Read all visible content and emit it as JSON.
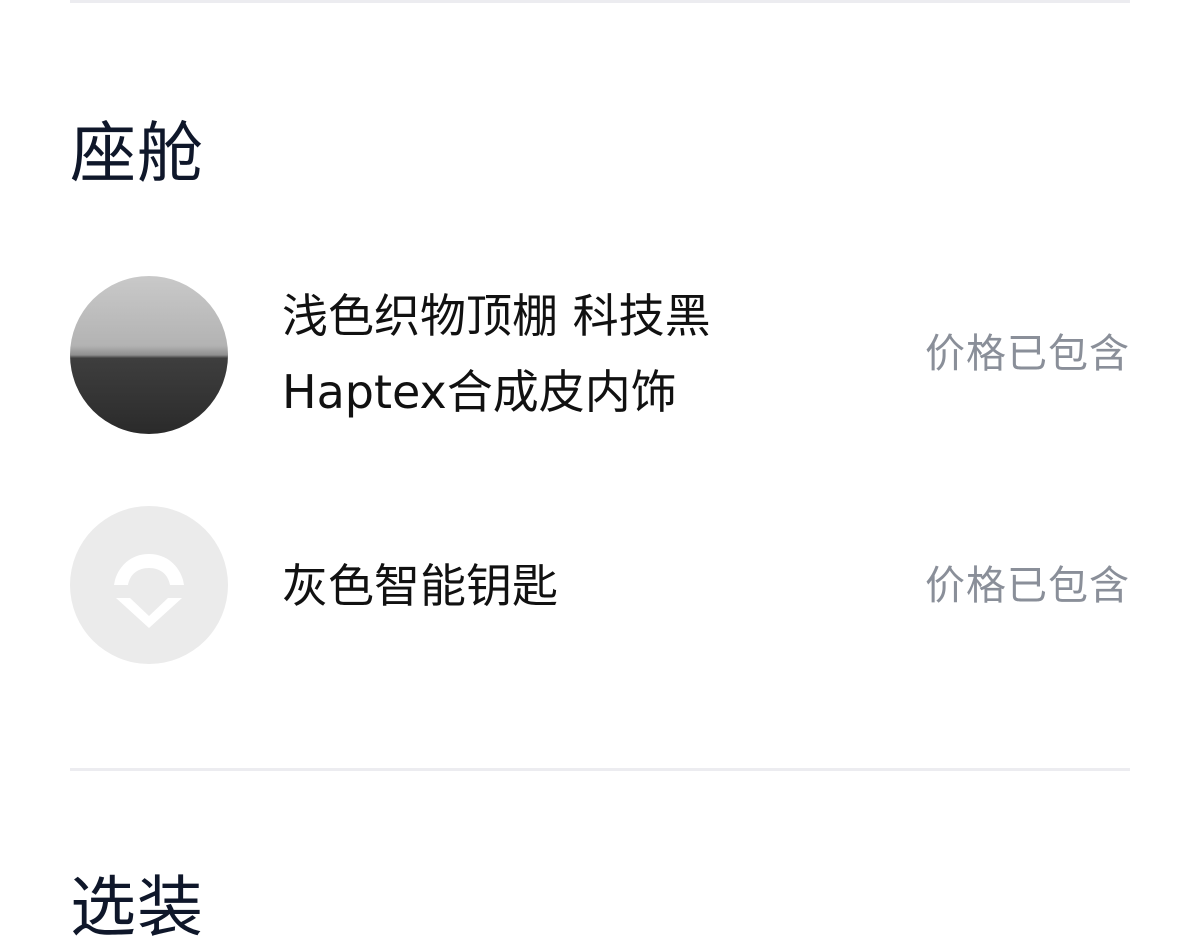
{
  "sections": {
    "cabin": {
      "title": "座舱",
      "items": [
        {
          "line1": "浅色织物顶棚 科技黑",
          "line2": "Haptex合成皮内饰",
          "price_note": "价格已包含",
          "thumb_icon": "interior-swatch"
        },
        {
          "line1": "灰色智能钥匙",
          "price_note": "价格已包含",
          "thumb_icon": "nio-logo-icon"
        }
      ]
    },
    "next_section": {
      "title": "选装"
    }
  },
  "colors": {
    "title": "#0f172a",
    "price_note": "#8a8f99",
    "divider": "#ececf0",
    "key_thumb_bg": "#ebebeb"
  }
}
